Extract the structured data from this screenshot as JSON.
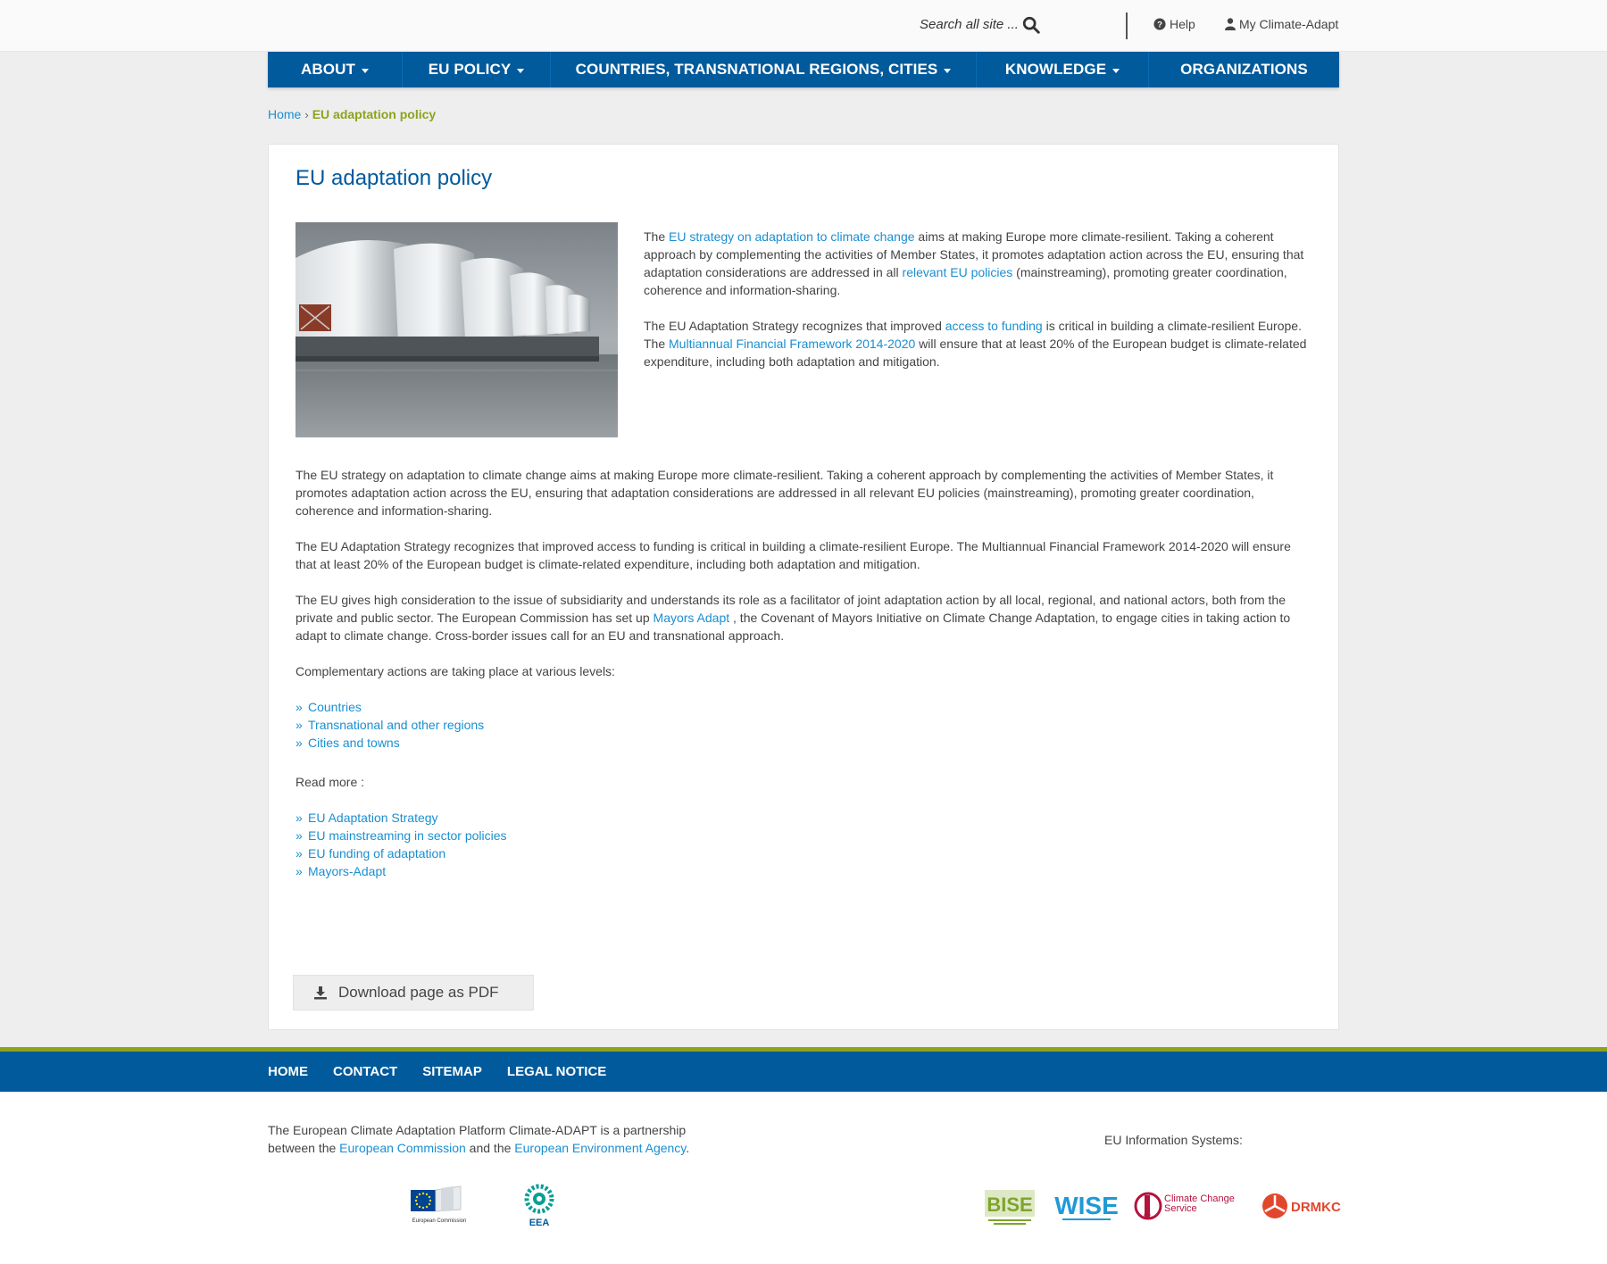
{
  "header": {
    "search_placeholder": "Search all site ...",
    "help_label": "Help",
    "account_label": "My Climate-Adapt"
  },
  "nav": {
    "items": [
      {
        "label": "ABOUT",
        "has_dropdown": true
      },
      {
        "label": "EU POLICY",
        "has_dropdown": true
      },
      {
        "label": "COUNTRIES, TRANSNATIONAL REGIONS, CITIES",
        "has_dropdown": true
      },
      {
        "label": "KNOWLEDGE",
        "has_dropdown": true
      },
      {
        "label": "ORGANIZATIONS",
        "has_dropdown": false
      }
    ]
  },
  "breadcrumb": {
    "home": "Home",
    "separator": "›",
    "current": "EU adaptation policy"
  },
  "main": {
    "title": "EU adaptation policy",
    "image_alt": "Thames barrier gates",
    "intro": {
      "p1_a": "The ",
      "p1_link1": "EU strategy on adaptation to climate change",
      "p1_b": " aims at making Europe more climate-resilient. Taking a coherent approach by complementing the activities of Member States, it promotes adaptation action across the EU, ensuring that adaptation considerations are addressed in all ",
      "p1_link2": "relevant EU policies",
      "p1_c": " (mainstreaming), promoting greater coordination, coherence and information-sharing.",
      "p2_a": "The EU Adaptation Strategy recognizes that improved ",
      "p2_link1": "access to funding",
      "p2_b": " is critical in building a climate-resilient Europe. The ",
      "p2_link2": "Multiannual Financial Framework 2014-2020",
      "p2_c": " will ensure that at least 20% of the European budget is climate-related expenditure, including both adaptation and mitigation."
    },
    "body": {
      "p1": "The EU strategy on adaptation to climate change aims at making Europe more climate-resilient. Taking a coherent approach by complementing the activities of Member States, it promotes adaptation action across the EU, ensuring that adaptation considerations are addressed in all relevant EU policies (mainstreaming), promoting greater coordination, coherence and information-sharing.",
      "p2": "The EU Adaptation Strategy recognizes that improved access to funding is critical in building a climate-resilient Europe. The Multiannual Financial Framework 2014-2020 will ensure that at least 20% of the European budget is climate-related expenditure, including both adaptation and mitigation.",
      "p3_a": "The EU gives high consideration to the issue of subsidiarity and understands its role as a facilitator of joint adaptation action by all local, regional, and national actors, both from the private and public sector. The European Commission has set up ",
      "p3_link": "Mayors Adapt",
      "p3_b": " , the Covenant of Mayors Initiative on Climate Change Adaptation, to engage cities in taking action to adapt to climate change. Cross-border issues call for an EU and transnational approach.",
      "p4": "Complementary actions are taking place at various levels:",
      "levels": [
        "Countries",
        "Transnational and other regions",
        "Cities and towns"
      ],
      "read_more_label": "Read more :",
      "read_more": [
        "EU Adaptation Strategy",
        "EU mainstreaming in sector policies",
        "EU funding of adaptation",
        "Mayors-Adapt"
      ]
    },
    "pdf_button": "Download page as PDF"
  },
  "footer": {
    "links": [
      "HOME",
      "CONTACT",
      "SITEMAP",
      "LEGAL NOTICE"
    ],
    "desc_a": "The European Climate Adaptation Platform Climate-ADAPT is a partnership between the ",
    "desc_link1": "European Commission",
    "desc_b": " and the ",
    "desc_link2": "European Environment Agency",
    "desc_c": ".",
    "eu_info_label": "EU Information Systems:",
    "logos": {
      "ec": "European Commission",
      "eea": "EEA",
      "bise": "BISE",
      "wise": "WISE",
      "ccs": "Climate Change Service",
      "drmkc": "DRMKC"
    }
  },
  "colors": {
    "primary": "#005a9c",
    "link": "#1a8fd1",
    "accent_green": "#8fa21c",
    "page_bg": "#eeeeee"
  }
}
